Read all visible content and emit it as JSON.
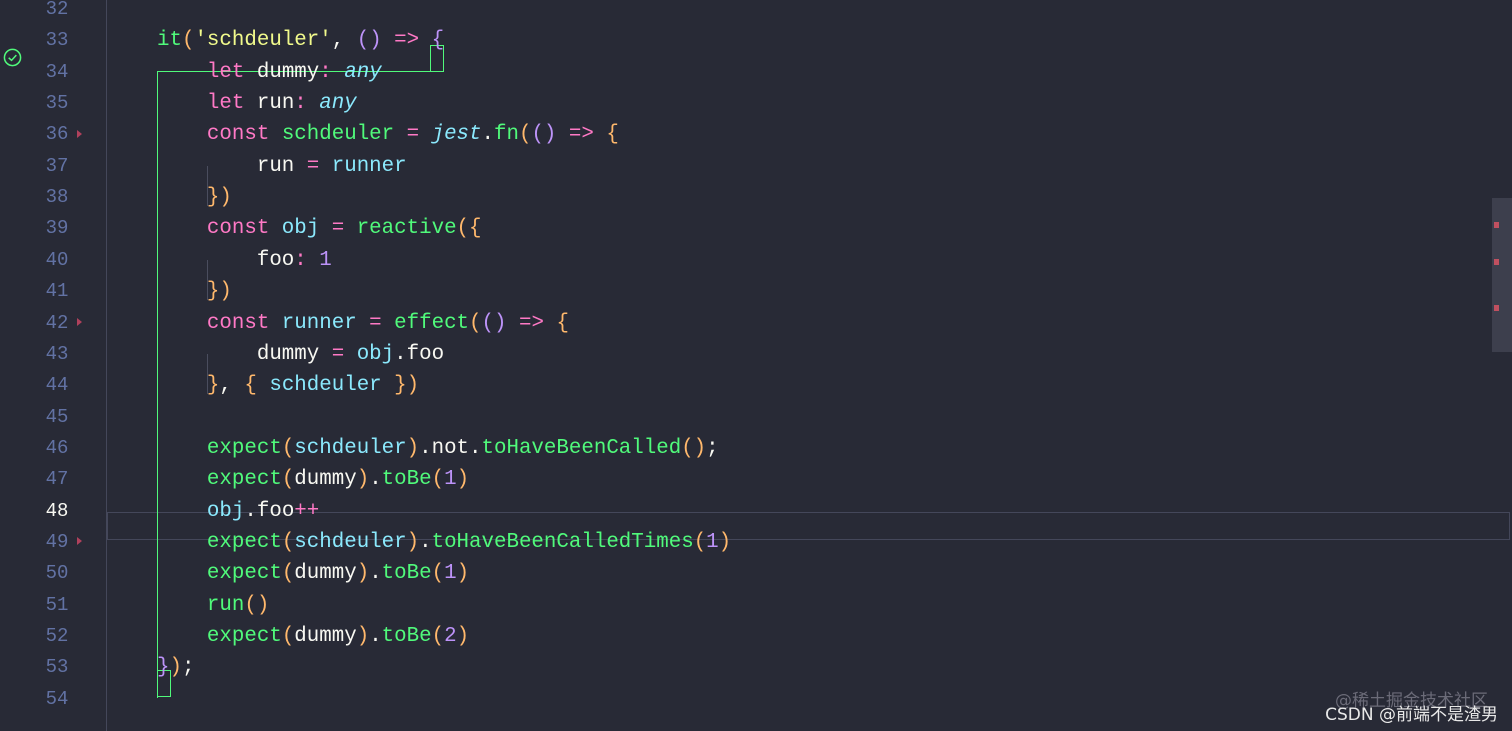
{
  "editor": {
    "theme_colors": {
      "background": "#282a36",
      "keyword": "#ff79c6",
      "function": "#50fa7b",
      "string": "#f1fa8c",
      "type": "#8be9fd",
      "number": "#bd93f9",
      "line_number": "#6272a4"
    },
    "active_line": "48",
    "test_status_icon": "check-circle-icon",
    "lines": [
      {
        "num": "32",
        "tokens": []
      },
      {
        "num": "33",
        "tokens": [
          [
            "f",
            "it"
          ],
          [
            "b1",
            "("
          ],
          [
            "s",
            "'schdeuler'"
          ],
          [
            "v",
            ", "
          ],
          [
            "b2",
            "()"
          ],
          [
            "o",
            " =>"
          ],
          [
            "v",
            " "
          ],
          [
            "b2",
            "{"
          ]
        ]
      },
      {
        "num": "34",
        "tokens": [
          [
            "v",
            "    "
          ],
          [
            "k",
            "let"
          ],
          [
            "v",
            " dummy"
          ],
          [
            "o",
            ":"
          ],
          [
            "v",
            " "
          ],
          [
            "t",
            "any"
          ]
        ]
      },
      {
        "num": "35",
        "tokens": [
          [
            "v",
            "    "
          ],
          [
            "k",
            "let"
          ],
          [
            "v",
            " run"
          ],
          [
            "o",
            ":"
          ],
          [
            "v",
            " "
          ],
          [
            "t",
            "any"
          ]
        ]
      },
      {
        "num": "36",
        "tokens": [
          [
            "v",
            "    "
          ],
          [
            "k",
            "const"
          ],
          [
            "v",
            " "
          ],
          [
            "f",
            "schdeuler"
          ],
          [
            "o",
            " ="
          ],
          [
            "v",
            " "
          ],
          [
            "t",
            "jest"
          ],
          [
            "v",
            "."
          ],
          [
            "f",
            "fn"
          ],
          [
            "b1",
            "("
          ],
          [
            "b2",
            "()"
          ],
          [
            "o",
            " =>"
          ],
          [
            "v",
            " "
          ],
          [
            "b1",
            "{"
          ]
        ]
      },
      {
        "num": "37",
        "tokens": [
          [
            "v",
            "        run"
          ],
          [
            "o",
            " ="
          ],
          [
            "pr",
            " runner"
          ]
        ]
      },
      {
        "num": "38",
        "tokens": [
          [
            "v",
            "    "
          ],
          [
            "b1",
            "})"
          ]
        ]
      },
      {
        "num": "39",
        "tokens": [
          [
            "v",
            "    "
          ],
          [
            "k",
            "const"
          ],
          [
            "pr",
            " obj"
          ],
          [
            "o",
            " ="
          ],
          [
            "v",
            " "
          ],
          [
            "f",
            "reactive"
          ],
          [
            "b1",
            "("
          ],
          [
            "b1",
            "{"
          ]
        ]
      },
      {
        "num": "40",
        "tokens": [
          [
            "v",
            "        foo"
          ],
          [
            "o",
            ":"
          ],
          [
            "n",
            " 1"
          ]
        ]
      },
      {
        "num": "41",
        "tokens": [
          [
            "v",
            "    "
          ],
          [
            "b1",
            "})"
          ]
        ]
      },
      {
        "num": "42",
        "tokens": [
          [
            "v",
            "    "
          ],
          [
            "k",
            "const"
          ],
          [
            "pr",
            " runner"
          ],
          [
            "o",
            " ="
          ],
          [
            "v",
            " "
          ],
          [
            "f",
            "effect"
          ],
          [
            "b1",
            "("
          ],
          [
            "b2",
            "()"
          ],
          [
            "o",
            " =>"
          ],
          [
            "v",
            " "
          ],
          [
            "b1",
            "{"
          ]
        ]
      },
      {
        "num": "43",
        "tokens": [
          [
            "v",
            "        dummy"
          ],
          [
            "o",
            " ="
          ],
          [
            "pr",
            " obj"
          ],
          [
            "v",
            ".foo"
          ]
        ]
      },
      {
        "num": "44",
        "tokens": [
          [
            "v",
            "    "
          ],
          [
            "b1",
            "}"
          ],
          [
            "v",
            ", "
          ],
          [
            "b1",
            "{"
          ],
          [
            "pr",
            " schdeuler"
          ],
          [
            "b1",
            " })"
          ]
        ]
      },
      {
        "num": "45",
        "tokens": []
      },
      {
        "num": "46",
        "tokens": [
          [
            "v",
            "    "
          ],
          [
            "f",
            "expect"
          ],
          [
            "b1",
            "("
          ],
          [
            "pr",
            "schdeuler"
          ],
          [
            "b1",
            ")"
          ],
          [
            "v",
            ".not."
          ],
          [
            "f",
            "toHaveBeenCalled"
          ],
          [
            "b1",
            "()"
          ],
          [
            "v",
            ";"
          ]
        ]
      },
      {
        "num": "47",
        "tokens": [
          [
            "v",
            "    "
          ],
          [
            "f",
            "expect"
          ],
          [
            "b1",
            "("
          ],
          [
            "v",
            "dummy"
          ],
          [
            "b1",
            ")"
          ],
          [
            "v",
            "."
          ],
          [
            "f",
            "toBe"
          ],
          [
            "b1",
            "("
          ],
          [
            "n",
            "1"
          ],
          [
            "b1",
            ")"
          ]
        ]
      },
      {
        "num": "48",
        "tokens": [
          [
            "v",
            "    "
          ],
          [
            "pr",
            "obj"
          ],
          [
            "v",
            ".foo"
          ],
          [
            "o",
            "++"
          ]
        ]
      },
      {
        "num": "49",
        "tokens": [
          [
            "v",
            "    "
          ],
          [
            "f",
            "expect"
          ],
          [
            "b1",
            "("
          ],
          [
            "pr",
            "schdeuler"
          ],
          [
            "b1",
            ")"
          ],
          [
            "v",
            "."
          ],
          [
            "f",
            "toHaveBeenCalledTimes"
          ],
          [
            "b1",
            "("
          ],
          [
            "n",
            "1"
          ],
          [
            "b1",
            ")"
          ]
        ]
      },
      {
        "num": "50",
        "tokens": [
          [
            "v",
            "    "
          ],
          [
            "f",
            "expect"
          ],
          [
            "b1",
            "("
          ],
          [
            "v",
            "dummy"
          ],
          [
            "b1",
            ")"
          ],
          [
            "v",
            "."
          ],
          [
            "f",
            "toBe"
          ],
          [
            "b1",
            "("
          ],
          [
            "n",
            "1"
          ],
          [
            "b1",
            ")"
          ]
        ]
      },
      {
        "num": "51",
        "tokens": [
          [
            "v",
            "    "
          ],
          [
            "f",
            "run"
          ],
          [
            "b1",
            "()"
          ]
        ]
      },
      {
        "num": "52",
        "tokens": [
          [
            "v",
            "    "
          ],
          [
            "f",
            "expect"
          ],
          [
            "b1",
            "("
          ],
          [
            "v",
            "dummy"
          ],
          [
            "b1",
            ")"
          ],
          [
            "v",
            "."
          ],
          [
            "f",
            "toBe"
          ],
          [
            "b1",
            "("
          ],
          [
            "n",
            "2"
          ],
          [
            "b1",
            ")"
          ]
        ]
      },
      {
        "num": "53",
        "tokens": [
          [
            "b2",
            "}"
          ],
          [
            "b1",
            ")"
          ],
          [
            "v",
            ";"
          ]
        ]
      },
      {
        "num": "54",
        "tokens": []
      }
    ]
  },
  "watermark": {
    "line1": "@稀土掘金技术社区",
    "line2": "CSDN @前端不是渣男"
  }
}
